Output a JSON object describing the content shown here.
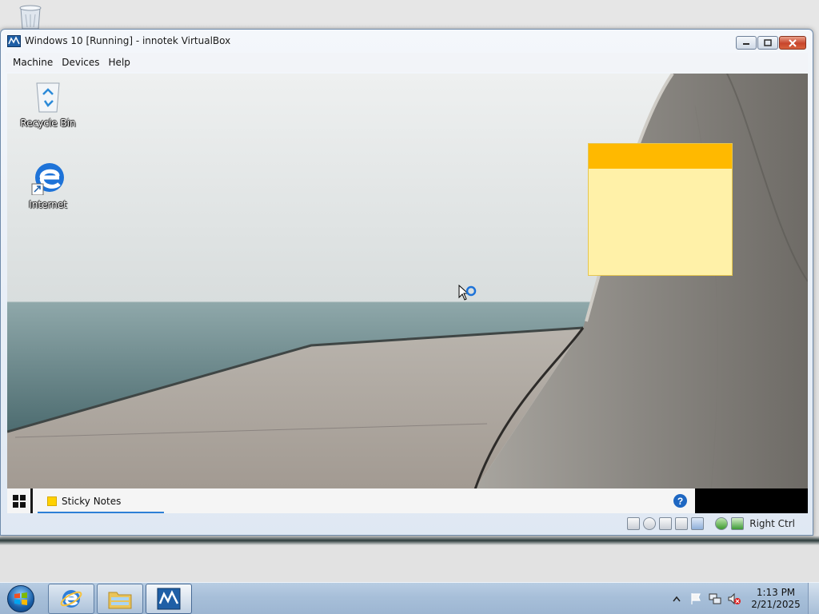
{
  "host": {
    "icons": {
      "recycle_bin": "recycle-bin-icon"
    },
    "taskbar": {
      "start": "windows-orb-icon",
      "pinned": [
        "internet-explorer-icon",
        "file-explorer-icon",
        "virtualbox-icon"
      ],
      "clock": {
        "time": "1:13 PM",
        "date": "2/21/2025"
      },
      "tray_icons": [
        "show-hidden-icons-icon",
        "action-center-flag-icon",
        "network-icon",
        "volume-muted-icon"
      ]
    }
  },
  "vbox": {
    "title": "Windows 10 [Running] - innotek VirtualBox",
    "menu": [
      "Machine",
      "Devices",
      "Help"
    ],
    "status_bar": {
      "icons": [
        "hard-disk-icon",
        "optical-drive-icon",
        "floppy-icon",
        "shared-folders-icon",
        "display-icon",
        "network-icon",
        "mouse-integration-icon"
      ],
      "host_key": "Right Ctrl"
    }
  },
  "guest": {
    "desktop_icons": [
      {
        "label": "Recycle Bin",
        "icon": "recycle-bin-icon"
      },
      {
        "label": "Internet",
        "icon": "edge-icon"
      }
    ],
    "taskbar": {
      "start": "windows-logo-icon",
      "task_label": "Sticky Notes",
      "help_icon": "?"
    },
    "sticky_note": {
      "header_color": "#ffb900",
      "body_color": "#fff1a8"
    }
  },
  "colors": {
    "accent": "#2d7fd6",
    "sticky_yellow": "#ffd100"
  }
}
